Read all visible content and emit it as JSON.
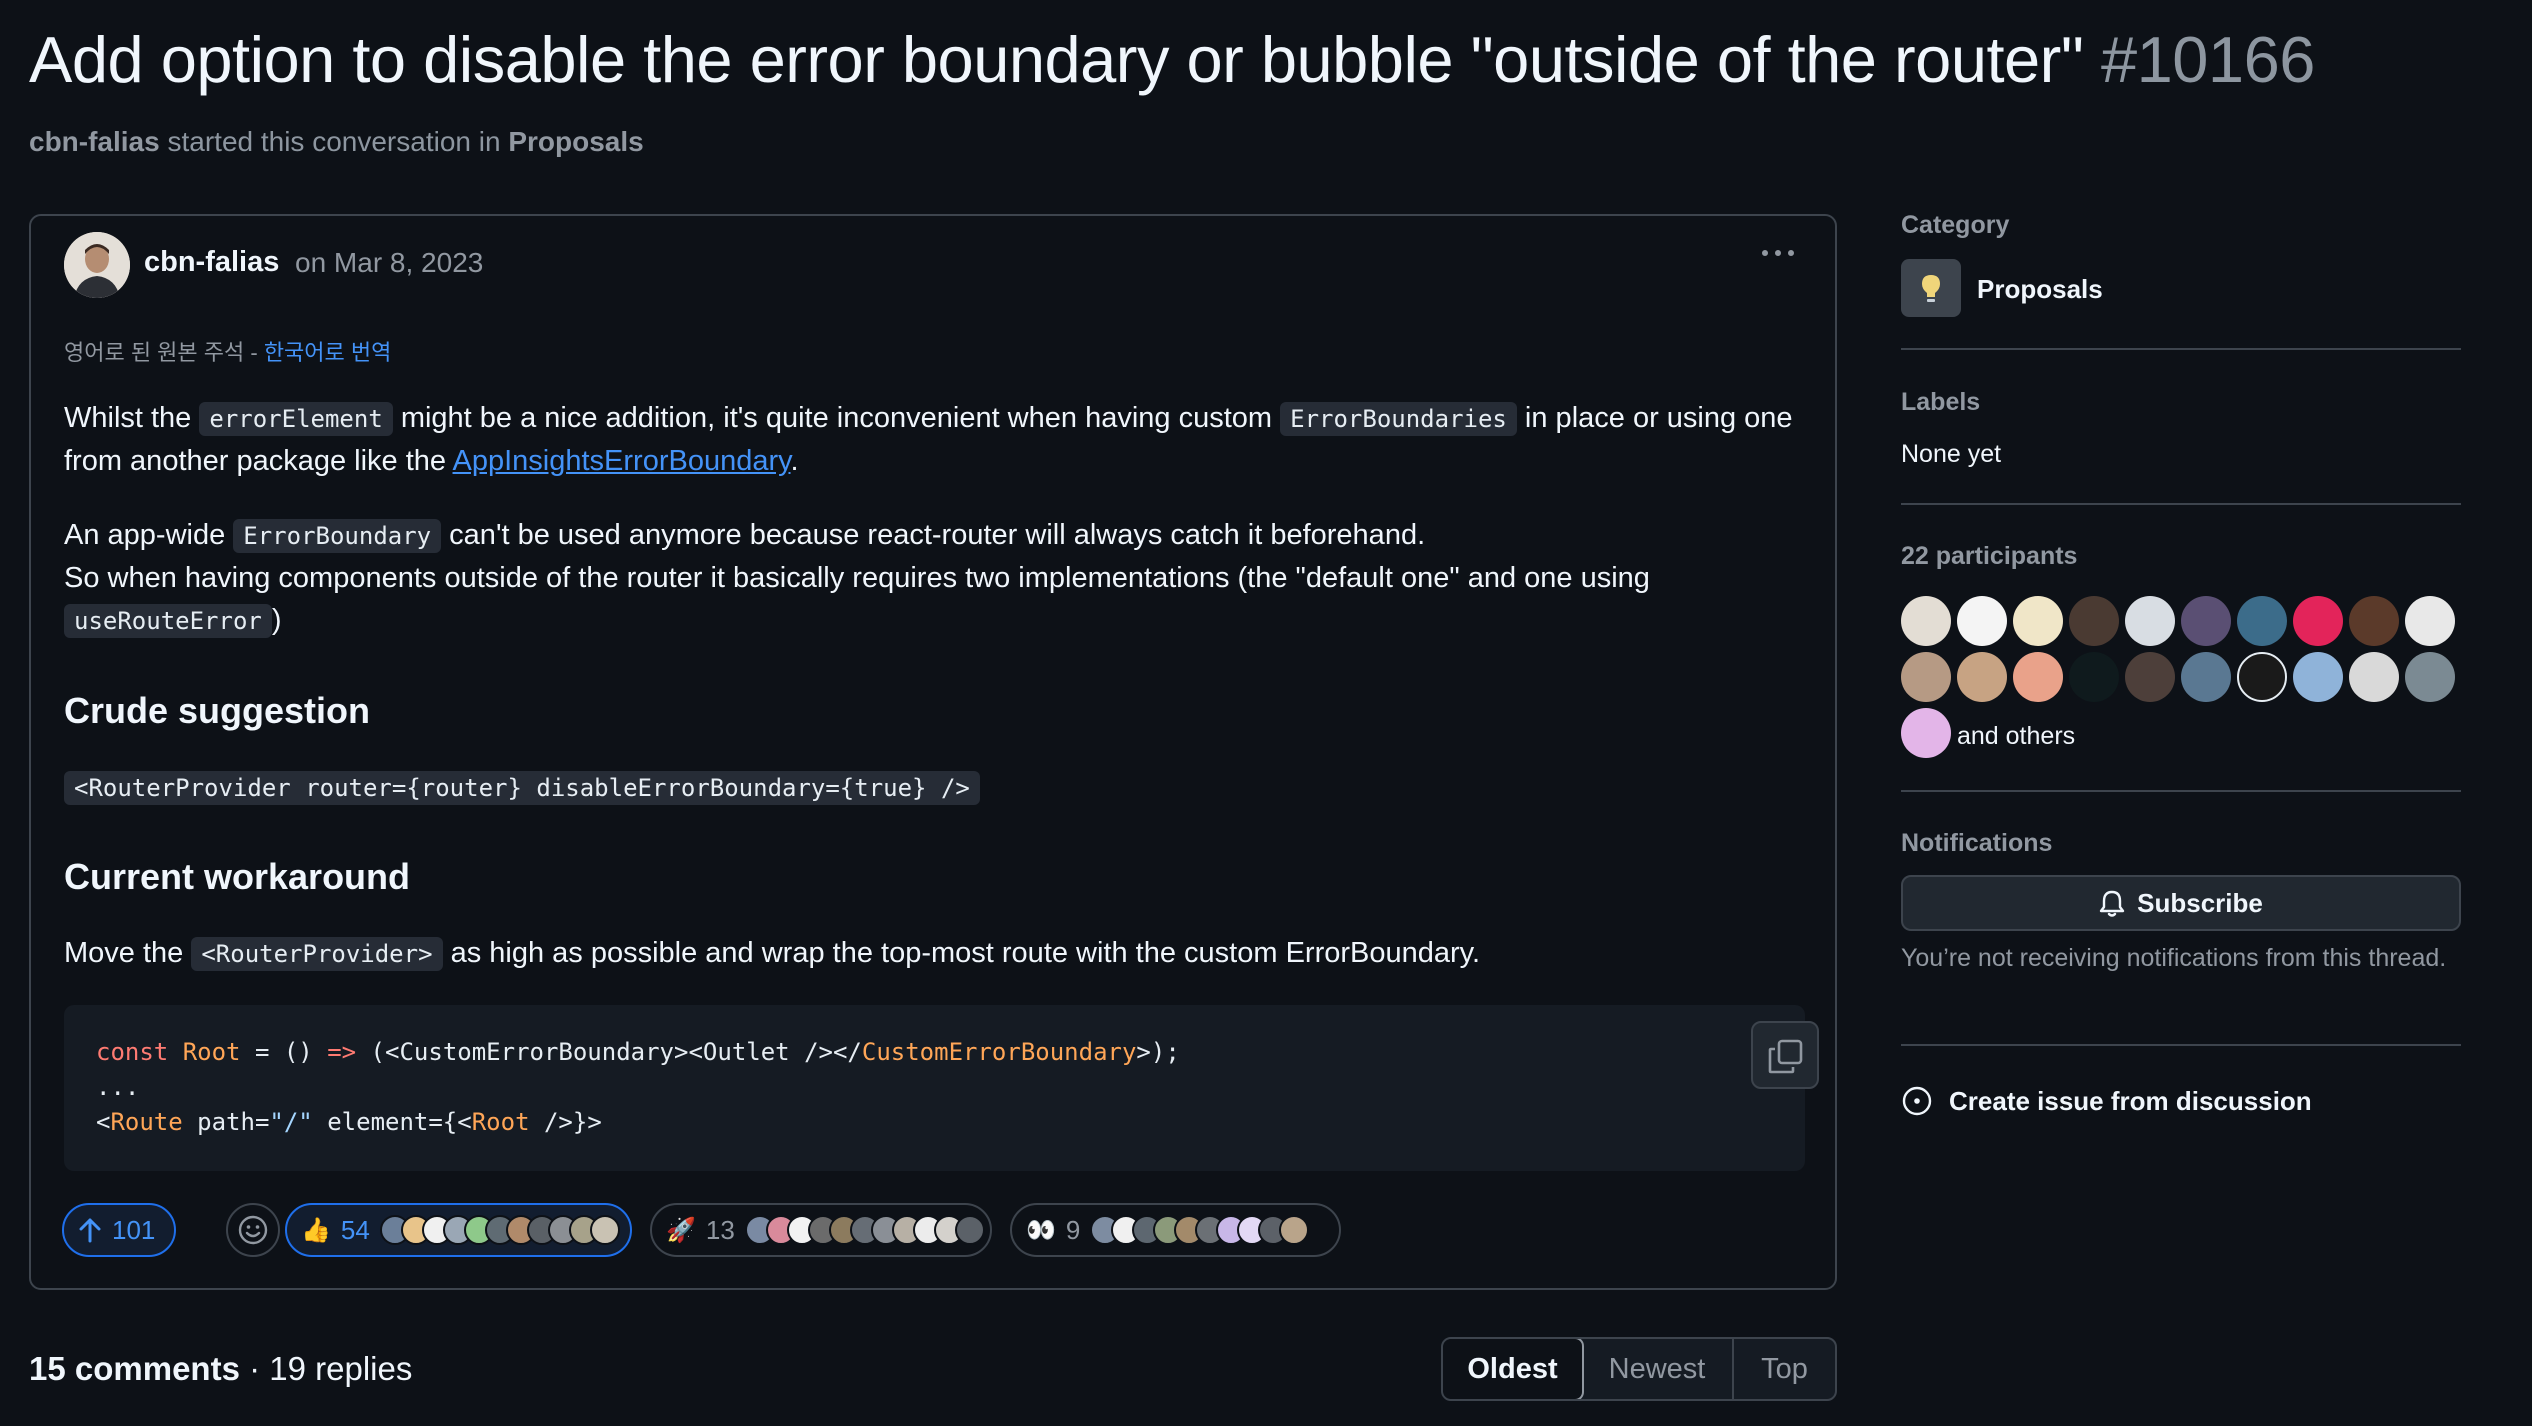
{
  "discussion": {
    "title": "Add option to disable the error boundary or bubble \"outside of the router\"",
    "number": "#10166",
    "starter": "cbn-falias",
    "started_text": "started this conversation in",
    "category_link": "Proposals"
  },
  "post": {
    "author": "cbn-falias",
    "date": "on Mar 8, 2023",
    "translate_prefix": "영어로 된 원본 주석 - ",
    "translate_link": "한국어로 번역",
    "p1_a": "Whilst the ",
    "p1_code1": "errorElement",
    "p1_b": " might be a nice addition, it's quite inconvenient when having custom ",
    "p1_code2": "ErrorBoundaries",
    "p1_c": " in place or using one from another package like the ",
    "p1_link": "AppInsightsErrorBoundary",
    "p1_d": ".",
    "p2_a": "An app-wide ",
    "p2_code": "ErrorBoundary",
    "p2_b": " can't be used anymore because react-router will always catch it beforehand.",
    "p2_c": "So when having components outside of the router it basically requires two implementations (the \"default one\" and one using ",
    "p2_code2": "useRouteError",
    "p2_d": ")",
    "h_suggestion": "Crude suggestion",
    "suggestion_code": "<RouterProvider router={router} disableErrorBoundary={true} />",
    "h_workaround": "Current workaround",
    "p3_a": "Move the ",
    "p3_code": "<RouterProvider>",
    "p3_b": " as high as possible and wrap the top-most route with the custom ErrorBoundary.",
    "code_lines": {
      "l1_const": "const",
      "l1_root": "Root",
      "l1_a": " = () ",
      "l1_arrow": "=>",
      "l1_b": " (<",
      "l1_ceb": "CustomErrorBoundary",
      "l1_c": "><",
      "l1_outlet": "Outlet",
      "l1_d": " /></",
      "l1_ceb2": "CustomErrorBoundary",
      "l1_e": ">);",
      "l2": "...",
      "l3_a": "<",
      "l3_route": "Route",
      "l3_b": " path=",
      "l3_str": "\"/\"",
      "l3_c": " element={<",
      "l3_root": "Root",
      "l3_d": " />}>"
    }
  },
  "reactions": {
    "upvotes": "101",
    "thumbs_count": "54",
    "rocket_count": "13",
    "eyes_count": "9"
  },
  "comments": {
    "count": "15 comments",
    "replies": " · 19 replies",
    "sort": [
      "Oldest",
      "Newest",
      "Top"
    ]
  },
  "sidebar": {
    "category_label": "Category",
    "category_name": "Proposals",
    "labels_label": "Labels",
    "labels_value": "None yet",
    "participants_label": "22 participants",
    "and_others": "and others",
    "notifications_label": "Notifications",
    "subscribe": "Subscribe",
    "notif_text": "You’re not receiving notifications from this thread.",
    "create_issue": "Create issue from discussion"
  },
  "colors": {
    "accent": "#4493f8",
    "background": "#0d1117",
    "border": "#3d444d"
  }
}
